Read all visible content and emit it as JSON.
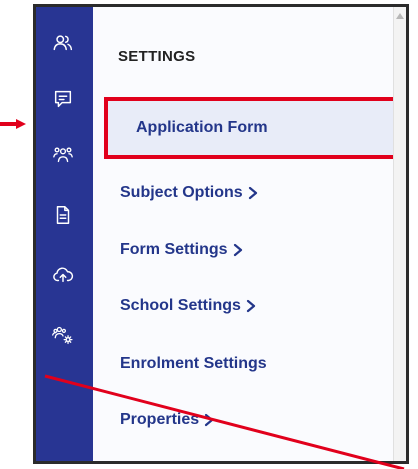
{
  "sidebar": {
    "icons": [
      "users-icon",
      "chat-icon",
      "group-icon",
      "document-icon",
      "cloud-upload-icon",
      "group-settings-icon"
    ]
  },
  "settings": {
    "title": "SETTINGS",
    "items": [
      {
        "label": "Application Form",
        "active": true,
        "has_chevron": false
      },
      {
        "label": "Subject Options",
        "active": false,
        "has_chevron": true
      },
      {
        "label": "Form Settings",
        "active": false,
        "has_chevron": true
      },
      {
        "label": "School Settings",
        "active": false,
        "has_chevron": true
      },
      {
        "label": "Enrolment Settings",
        "active": false,
        "has_chevron": false
      },
      {
        "label": "Properties",
        "active": false,
        "has_chevron": true
      }
    ]
  },
  "colors": {
    "rail": "#283593",
    "menu_text": "#23368a",
    "highlight_border": "#e1001c",
    "annotation": "#e1001c"
  }
}
